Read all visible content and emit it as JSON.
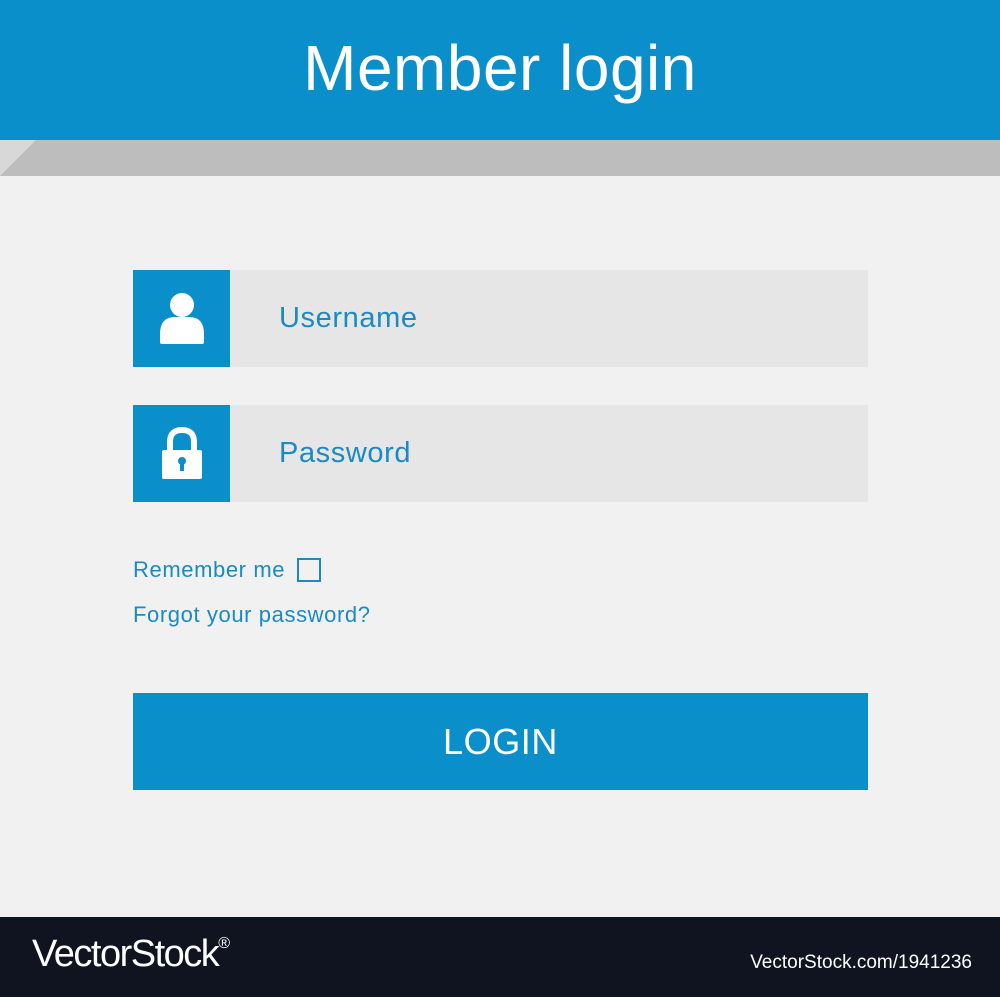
{
  "header": {
    "title": "Member login"
  },
  "form": {
    "username_placeholder": "Username",
    "password_placeholder": "Password",
    "remember_label": "Remember me",
    "remember_checked": false,
    "forgot_link": "Forgot your password?",
    "login_label": "LOGIN"
  },
  "icons": {
    "username": "user-icon",
    "password": "lock-icon"
  },
  "footer": {
    "logo_text": "VectorStock",
    "logo_mark": "®",
    "image_ref": "VectorStock.com/1941236"
  },
  "colors": {
    "accent": "#0a8fcb",
    "text_accent": "#1a8ac3",
    "background": "#f1f1f1",
    "field_background": "#e6e6e6",
    "footer_background": "#0f1420"
  }
}
